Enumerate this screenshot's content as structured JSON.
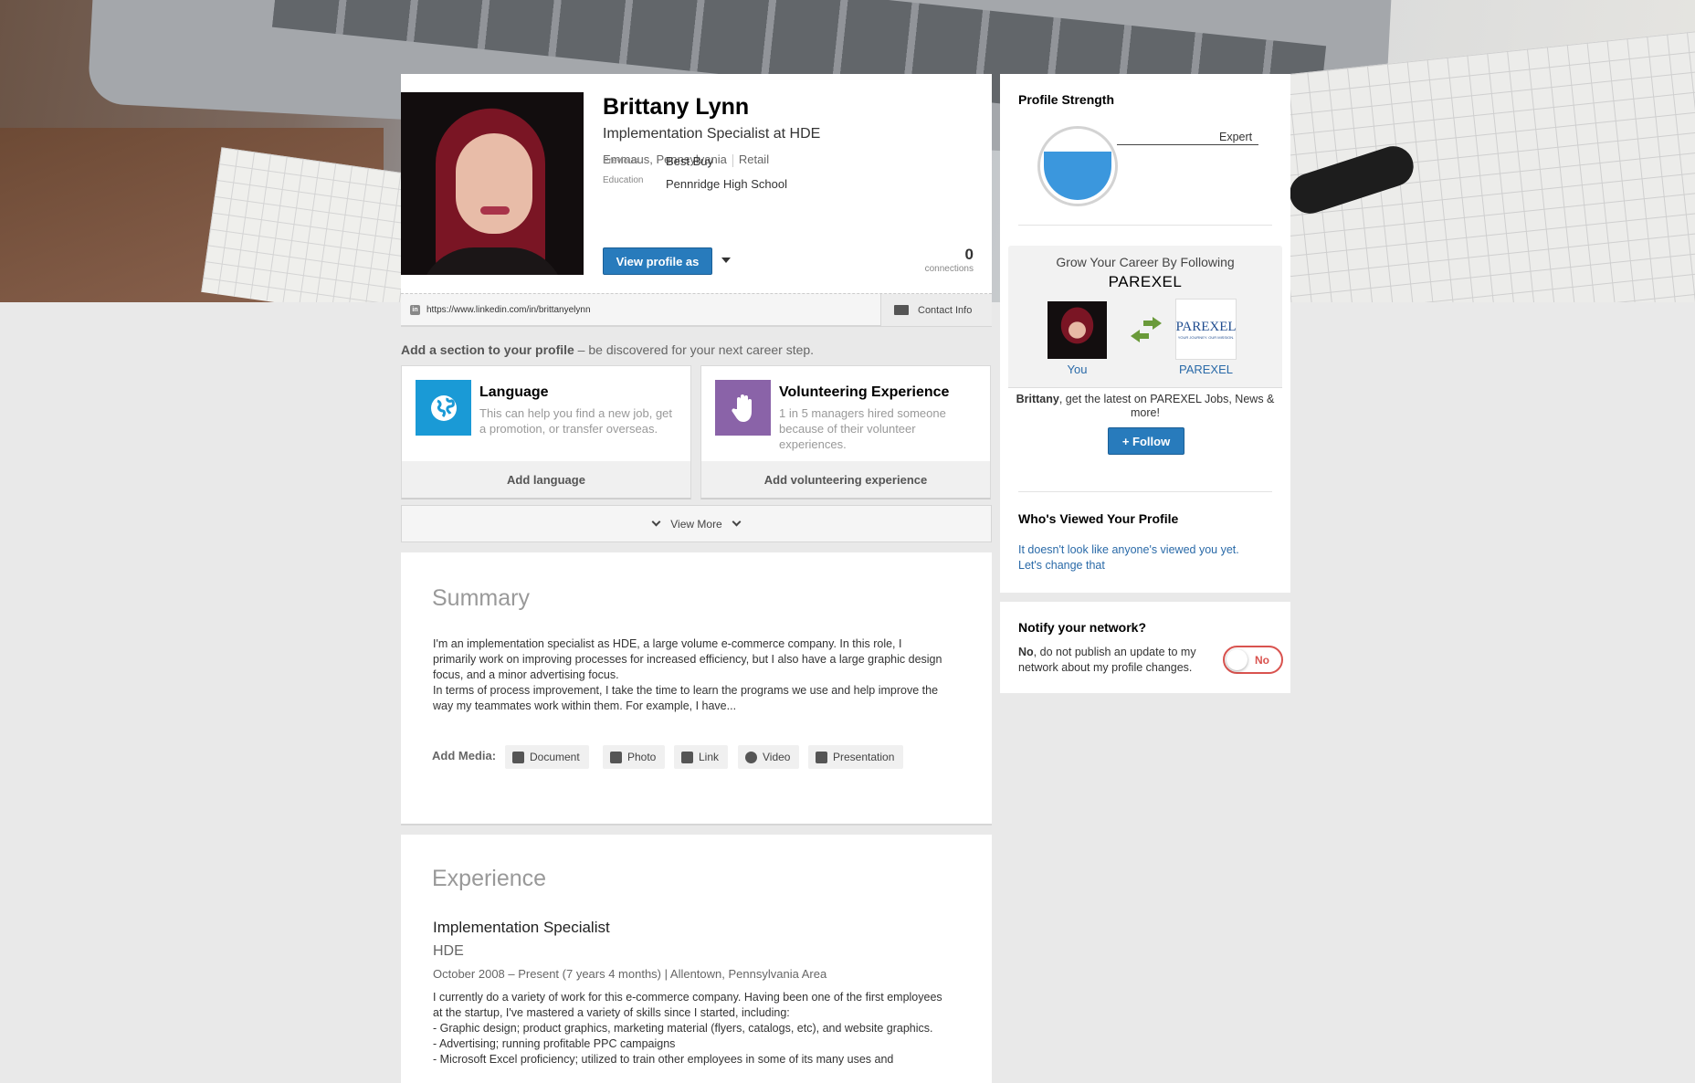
{
  "profile": {
    "name": "Brittany Lynn",
    "headline": "Implementation Specialist at HDE",
    "location": "Emmaus, Pennsylvania",
    "industry": "Retail",
    "previous_label": "Previous",
    "previous_value": "Best Buy",
    "education_label": "Education",
    "education_value": "Pennridge High School",
    "view_profile_button": "View profile as",
    "connections_count": "0",
    "connections_label": "connections",
    "public_url": "https://www.linkedin.com/in/brittanyelynn",
    "contact_info": "Contact Info"
  },
  "add_section": {
    "prompt_bold": "Add a section to your profile",
    "prompt_rest": " – be discovered for your next career step.",
    "cards": [
      {
        "title": "Language",
        "description": "This can help you find a new job, get a promotion, or transfer overseas.",
        "action": "Add language",
        "icon": "globe-icon",
        "color": "#1a9ad6"
      },
      {
        "title": "Volunteering Experience",
        "description": "1 in 5 managers hired someone because of their volunteer experiences.",
        "action": "Add volunteering experience",
        "icon": "hand-icon",
        "color": "#8a63a8"
      }
    ],
    "view_more": "View More"
  },
  "summary": {
    "heading": "Summary",
    "text_p1": "I'm an implementation specialist as HDE, a large volume e-commerce company. In this role, I primarily work on improving processes for increased efficiency, but I also have a large graphic design focus, and a minor advertising focus.",
    "text_p2": "In terms of process improvement, I take the time to learn the programs we use and help improve the way my teammates work within them. For example, I have...",
    "add_media_label": "Add Media:",
    "media_buttons": [
      "Document",
      "Photo",
      "Link",
      "Video",
      "Presentation"
    ]
  },
  "experience": {
    "heading": "Experience",
    "title": "Implementation Specialist",
    "company": "HDE",
    "dates": "October 2008 – Present (7 years 4 months) | Allentown, Pennsylvania Area",
    "description": [
      "I currently do a variety of work for this e-commerce company. Having been one of the first employees at the startup, I've mastered a variety of skills since I started, including:",
      "- Graphic design; product graphics, marketing material (flyers, catalogs, etc), and website graphics.",
      "- Advertising; running profitable PPC campaigns",
      "- Microsoft Excel proficiency; utilized to train other employees in some of its many uses and"
    ]
  },
  "sidebar": {
    "profile_strength_heading": "Profile Strength",
    "profile_strength_level": "Expert",
    "profile_strength_fraction": 0.72,
    "grow_heading": "Grow Your Career By Following",
    "company_name": "PAREXEL",
    "company_logo_text": "PAREXEL",
    "company_logo_tagline": "YOUR JOURNEY. OUR MISSION.",
    "you_label": "You",
    "follow_user": "Brittany",
    "follow_text": ", get the latest on PAREXEL Jobs, News & more!",
    "follow_button": "+ Follow",
    "viewed_heading": "Who's Viewed Your Profile",
    "viewed_text": "It doesn't look like anyone's viewed you yet. Let's change that",
    "notify_heading": "Notify your network?",
    "notify_bold": "No",
    "notify_text": ", do not publish an update to my network about my profile changes.",
    "notify_toggle": "No"
  }
}
